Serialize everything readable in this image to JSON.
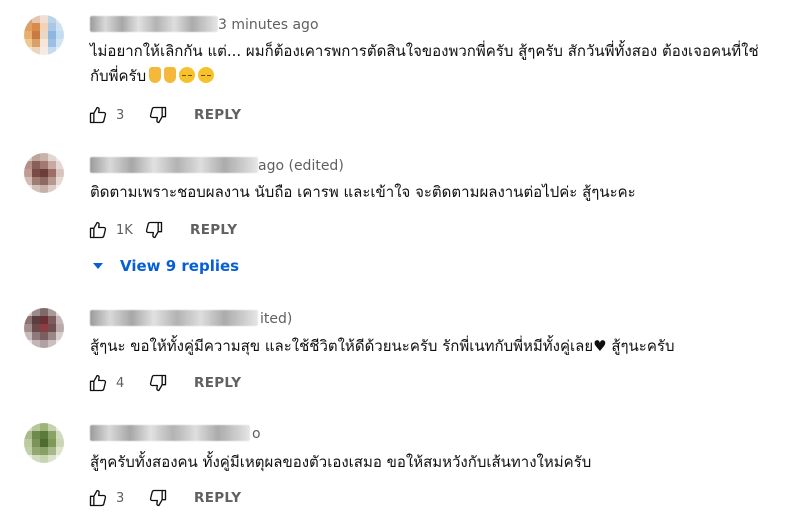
{
  "comments": [
    {
      "meta": "3 minutes ago",
      "text": "ไม่อยากให้เลิกกัน แต่... ผมก็ต้องเคารพการตัดสินใจของพวกพี่ครับ สู้ๆครับ สักวันพี่ทั้งสอง ต้องเจอคนที่ใช่ กับพี่ครับ",
      "emojis": [
        "victory-hand-emoji",
        "victory-hand-emoji",
        "pensive-face-emoji",
        "pensive-face-emoji"
      ],
      "likes": "3",
      "reply_label": "REPLY",
      "avatar_colors": [
        "#c9a38a",
        "#e6c6b0",
        "#f0e0d4",
        "#b9d3e8",
        "#d9e6f2",
        "#e0a062",
        "#d98b4c",
        "#f2d2b8",
        "#a8c8e6",
        "#cfe0f0",
        "#e8b070",
        "#c97a43",
        "#e9d7c7",
        "#8fb6dd",
        "#c4dcf0",
        "#f1c890",
        "#d8a06a",
        "#f5e6d8",
        "#9cc0e4",
        "#d3e3f2",
        "#f6e3cf",
        "#eed4bb",
        "#f4ece4",
        "#c6dbef",
        "#e4eef7"
      ]
    },
    {
      "meta": "ago (edited)",
      "text": "ติดตามเพราะชอบผลงาน นับถือ เคารพ และเข้าใจ จะติดตามผลงานต่อไปค่ะ สู้ๆนะคะ",
      "likes": "1K",
      "reply_label": "REPLY",
      "avatar_colors": [
        "#d8c8c4",
        "#bfa49c",
        "#c9b2aa",
        "#e2d6d2",
        "#f0e8e6",
        "#b48f86",
        "#8a5f58",
        "#a37a72",
        "#c7aaa3",
        "#e5d8d4",
        "#c29c92",
        "#7a4a44",
        "#6e3d38",
        "#9c6e66",
        "#d8c4be",
        "#d4bcb6",
        "#a07c74",
        "#8e6a62",
        "#b8978f",
        "#e6dad6",
        "#ece2df",
        "#d2c0bb",
        "#c6b0aa",
        "#dccdc9",
        "#f2ecea"
      ]
    },
    {
      "meta": "ited)",
      "text": "สู้ๆนะ  ขอให้ทั้งคู่มีความสุข และใช้ชีวิตให้ดีด้วยนะครับ รักพี่เนทกับพี่หมีทั้งคู่เลย♥ สู้ๆนะครับ",
      "likes": "4",
      "reply_label": "REPLY",
      "avatar_colors": [
        "#cfc3c3",
        "#9d8c8c",
        "#7e6a6b",
        "#a99a9a",
        "#e0d8d8",
        "#8c7475",
        "#5a3f41",
        "#6b2f34",
        "#7d5a5c",
        "#c4b6b6",
        "#a48e8e",
        "#6e4a4d",
        "#8a3d44",
        "#704e51",
        "#b9a9a9",
        "#c7baba",
        "#8f7a7b",
        "#7a5f61",
        "#9b8787",
        "#d6cdcd",
        "#e6e0e0",
        "#c2b6b6",
        "#b0a2a2",
        "#cbc0c0",
        "#efebeb"
      ]
    },
    {
      "meta": "o",
      "text": "สู้ๆครับทั้งสองคน ทั้งคู่มีเหตุผลของตัวเองเสมอ ขอให้สมหวังกับเส้นทางใหม่ครับ",
      "likes": "3",
      "reply_label": "REPLY",
      "avatar_colors": [
        "#d5dcc4",
        "#b8c79a",
        "#9eb27a",
        "#c6d2ae",
        "#e6ebdc",
        "#a8b98a",
        "#6f8a4c",
        "#5c7a3a",
        "#8aa266",
        "#d0dabd",
        "#bccb9f",
        "#7c9458",
        "#4f6b32",
        "#7e9a5a",
        "#c9d5b4",
        "#c3cfa8",
        "#93a871",
        "#88a066",
        "#a7b98a",
        "#dde5cf",
        "#ebefe2",
        "#d2dbc0",
        "#c8d3b2",
        "#dbe3cb",
        "#f2f5ec"
      ]
    }
  ],
  "view_replies": {
    "label": "View 9 replies"
  },
  "colors": {
    "link": "#065fd4",
    "secondary_text": "#606060",
    "text": "#0f0f0f"
  },
  "icons": {
    "like": "thumb-up-icon",
    "dislike": "thumb-down-icon",
    "expand": "caret-down-icon"
  }
}
